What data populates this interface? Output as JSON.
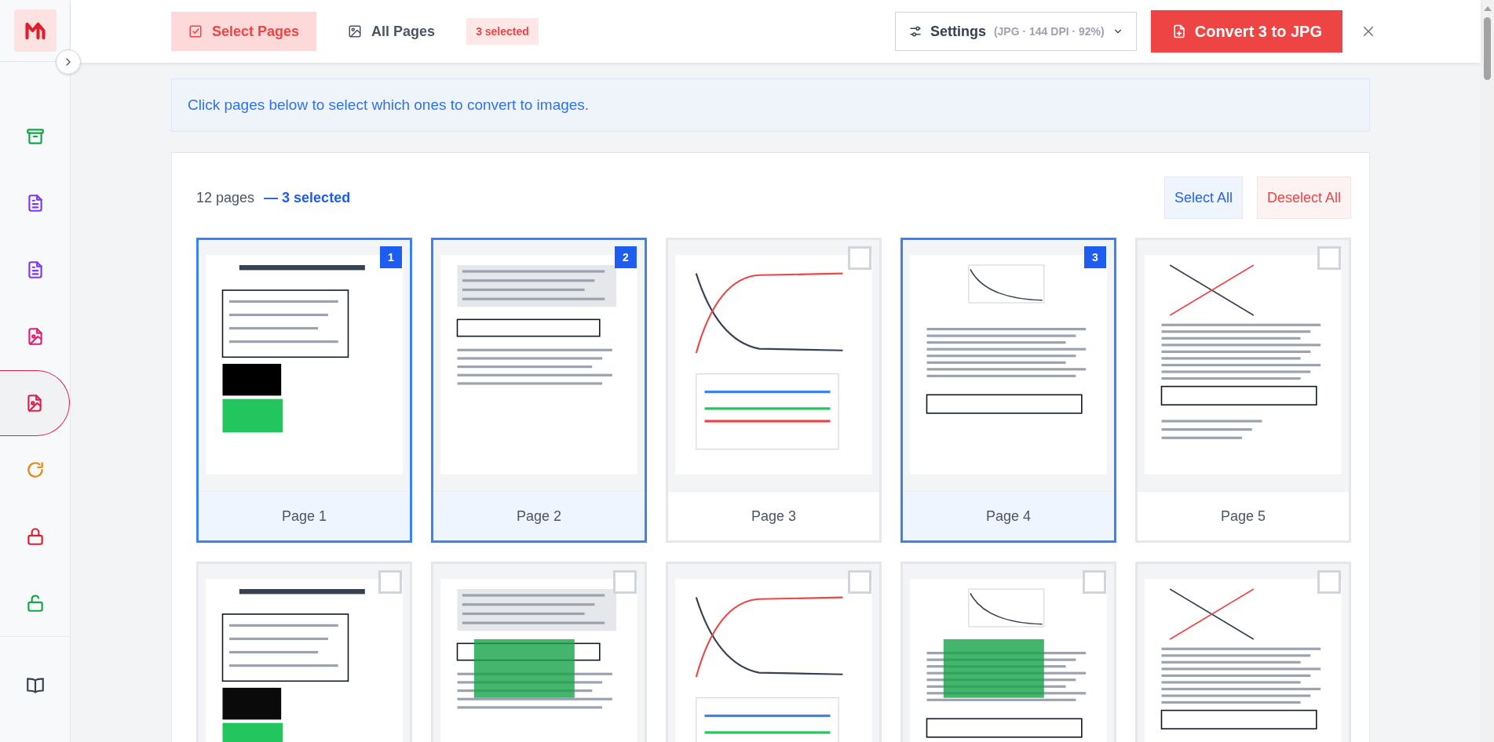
{
  "sidebar": {
    "items": [
      {
        "color": "#16a34a",
        "selected": false
      },
      {
        "color": "#7c3aed",
        "selected": false
      },
      {
        "color": "#7c3aed",
        "selected": false
      },
      {
        "color": "#e11d74",
        "selected": false
      },
      {
        "color": "#e11d48",
        "selected": true
      },
      {
        "color": "#e8850c",
        "selected": false
      },
      {
        "color": "#e11d2e",
        "selected": false
      },
      {
        "color": "#16a34a",
        "selected": false
      }
    ],
    "footer_items": [
      {
        "color": "#374151",
        "selected": false
      }
    ]
  },
  "toolbar": {
    "tabs": [
      {
        "label": "Select Pages",
        "selected": true
      },
      {
        "label": "All Pages",
        "selected": false
      }
    ],
    "selection_badge": "3 selected",
    "settings": {
      "label": "Settings",
      "summary": "(JPG · 144 DPI · 92%)"
    },
    "convert_button": "Convert 3 to JPG"
  },
  "banner": "Click pages below to select which ones to convert to images.",
  "pages_panel": {
    "count": "12 pages",
    "selected_count": "— 3 selected",
    "buttons": [
      "Select All",
      "Deselect All"
    ],
    "pages": [
      {
        "label": "Page 1",
        "selected": true,
        "badge": "1"
      },
      {
        "label": "Page 2",
        "selected": true,
        "badge": "2"
      },
      {
        "label": "Page 3",
        "selected": false
      },
      {
        "label": "Page 4",
        "selected": true,
        "badge": "3"
      },
      {
        "label": "Page 5",
        "selected": false
      },
      {
        "selected": false
      },
      {
        "selected": false
      },
      {
        "selected": false
      },
      {
        "selected": false
      },
      {
        "selected": false
      }
    ]
  }
}
